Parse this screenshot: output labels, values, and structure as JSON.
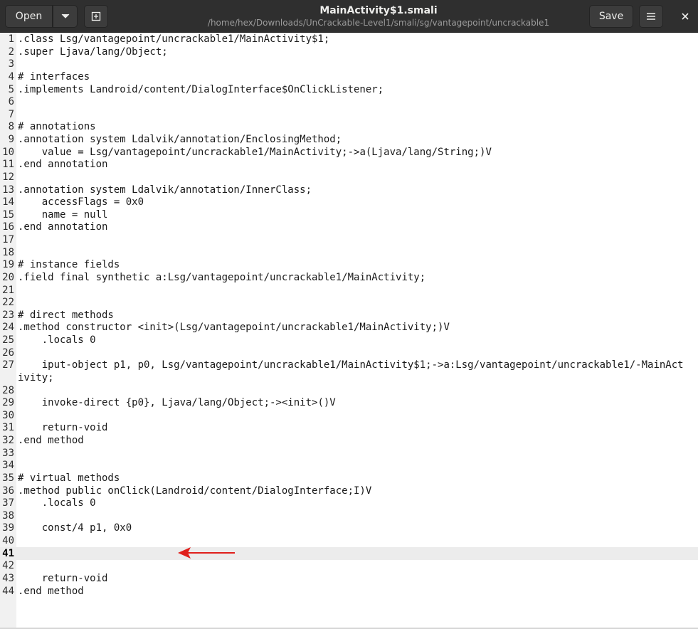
{
  "header": {
    "open_label": "Open",
    "title": "MainActivity$1.smali",
    "path": "/home/hex/Downloads/UnCrackable-Level1/smali/sg/vantagepoint/uncrackable1",
    "save_label": "Save",
    "icons": {
      "open_menu": "chevron-down-icon",
      "new_tab": "new-document-icon",
      "menu": "hamburger-icon",
      "close": "close-icon"
    }
  },
  "editor": {
    "current_line": 41,
    "lines": [
      ".class Lsg/vantagepoint/uncrackable1/MainActivity$1;",
      ".super Ljava/lang/Object;",
      "",
      "# interfaces",
      ".implements Landroid/content/DialogInterface$OnClickListener;",
      "",
      "",
      "# annotations",
      ".annotation system Ldalvik/annotation/EnclosingMethod;",
      "    value = Lsg/vantagepoint/uncrackable1/MainActivity;->a(Ljava/lang/String;)V",
      ".end annotation",
      "",
      ".annotation system Ldalvik/annotation/InnerClass;",
      "    accessFlags = 0x0",
      "    name = null",
      ".end annotation",
      "",
      "",
      "# instance fields",
      ".field final synthetic a:Lsg/vantagepoint/uncrackable1/MainActivity;",
      "",
      "",
      "# direct methods",
      ".method constructor <init>(Lsg/vantagepoint/uncrackable1/MainActivity;)V",
      "    .locals 0",
      "",
      "    iput-object p1, p0, Lsg/vantagepoint/uncrackable1/MainActivity$1;->a:Lsg/vantagepoint/uncrackable1/-MainActivity;",
      "",
      "    invoke-direct {p0}, Ljava/lang/Object;-><init>()V",
      "",
      "    return-void",
      ".end method",
      "",
      "",
      "# virtual methods",
      ".method public onClick(Landroid/content/DialogInterface;I)V",
      "    .locals 0",
      "",
      "    const/4 p1, 0x0",
      "",
      "",
      "",
      "    return-void",
      ".end method"
    ]
  },
  "annotation_arrow_color": "#e0201c"
}
